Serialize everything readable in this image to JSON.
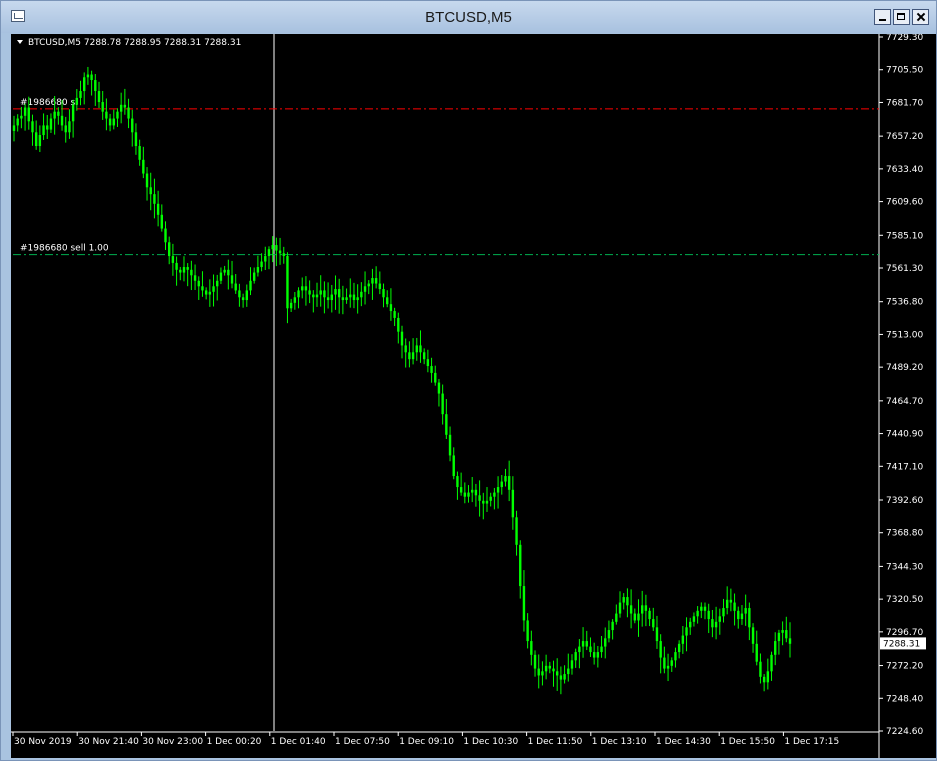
{
  "window": {
    "title": "BTCUSD,M5"
  },
  "chart_info": {
    "text": "BTCUSD,M5  7288.78 7288.95 7288.31 7288.31"
  },
  "chart_data": {
    "type": "candlestick",
    "symbol": "BTCUSD",
    "timeframe": "M5",
    "ohlc_header": {
      "open": 7288.78,
      "high": 7288.95,
      "low": 7288.31,
      "close": 7288.31
    },
    "current_price": "7288.31",
    "price_axis": [
      "7729.30",
      "7705.50",
      "7681.70",
      "7657.20",
      "7633.40",
      "7609.60",
      "7585.10",
      "7561.30",
      "7536.80",
      "7513.00",
      "7489.20",
      "7464.70",
      "7440.90",
      "7417.10",
      "7392.60",
      "7368.80",
      "7344.30",
      "7320.50",
      "7296.70",
      "7272.20",
      "7248.40",
      "7224.60"
    ],
    "ylim": [
      7224.6,
      7729.3
    ],
    "time_axis": [
      "30 Nov 2019",
      "30 Nov 21:40",
      "30 Nov 23:00",
      "1 Dec 00:20",
      "1 Dec 01:40",
      "1 Dec 07:50",
      "1 Dec 09:10",
      "1 Dec 10:30",
      "1 Dec 11:50",
      "1 Dec 13:10",
      "1 Dec 14:30",
      "1 Dec 15:50",
      "1 Dec 17:15"
    ],
    "close_series": [
      7665,
      7670,
      7672,
      7678,
      7668,
      7660,
      7650,
      7658,
      7665,
      7662,
      7670,
      7675,
      7672,
      7665,
      7660,
      7668,
      7680,
      7685,
      7690,
      7700,
      7702,
      7698,
      7690,
      7682,
      7675,
      7670,
      7665,
      7670,
      7675,
      7680,
      7678,
      7670,
      7660,
      7650,
      7640,
      7630,
      7620,
      7615,
      7608,
      7600,
      7590,
      7580,
      7570,
      7565,
      7560,
      7558,
      7562,
      7560,
      7556,
      7552,
      7548,
      7545,
      7542,
      7544,
      7548,
      7552,
      7558,
      7560,
      7556,
      7550,
      7545,
      7540,
      7538,
      7545,
      7552,
      7558,
      7562,
      7566,
      7570,
      7575,
      7578,
      7574,
      7572,
      7570,
      7532,
      7536,
      7540,
      7545,
      7548,
      7545,
      7542,
      7540,
      7542,
      7545,
      7540,
      7538,
      7542,
      7546,
      7540,
      7538,
      7540,
      7542,
      7538,
      7540,
      7544,
      7548,
      7550,
      7554,
      7550,
      7546,
      7540,
      7535,
      7530,
      7525,
      7515,
      7505,
      7500,
      7495,
      7500,
      7505,
      7500,
      7495,
      7490,
      7485,
      7478,
      7470,
      7455,
      7440,
      7425,
      7410,
      7402,
      7398,
      7395,
      7398,
      7400,
      7396,
      7392,
      7390,
      7392,
      7395,
      7398,
      7402,
      7406,
      7410,
      7400,
      7380,
      7360,
      7330,
      7305,
      7290,
      7280,
      7270,
      7265,
      7268,
      7272,
      7270,
      7268,
      7265,
      7262,
      7266,
      7270,
      7276,
      7282,
      7286,
      7290,
      7286,
      7282,
      7278,
      7282,
      7286,
      7292,
      7298,
      7304,
      7310,
      7318,
      7322,
      7316,
      7310,
      7305,
      7310,
      7316,
      7312,
      7306,
      7300,
      7290,
      7278,
      7270,
      7272,
      7276,
      7282,
      7288,
      7294,
      7300,
      7304,
      7308,
      7312,
      7315,
      7312,
      7306,
      7300,
      7304,
      7308,
      7314,
      7320,
      7318,
      7312,
      7306,
      7310,
      7314,
      7300,
      7288,
      7275,
      7264,
      7260,
      7268,
      7280,
      7290,
      7296,
      7298,
      7292,
      7288
    ],
    "trade_lines": [
      {
        "label": "#1986680 sl",
        "price": 7677.0
      },
      {
        "label": "#1986680 sell 1.00",
        "price": 7571.0
      }
    ],
    "grid": false
  },
  "colors": {
    "background": "#000000",
    "candle": "#00ff00",
    "sl_line": "#ff0000",
    "sell_line": "#00b050",
    "axis_text": "#ffffff"
  }
}
